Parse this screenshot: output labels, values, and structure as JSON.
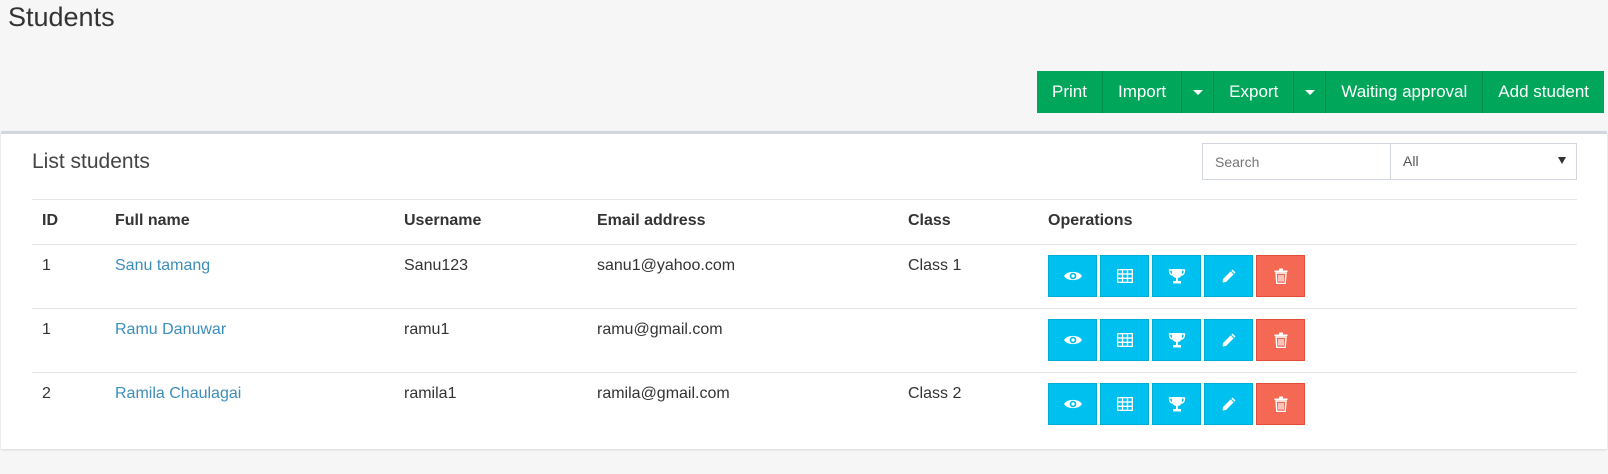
{
  "page": {
    "title": "Students"
  },
  "toolbar": {
    "print": "Print",
    "import": "Import",
    "export": "Export",
    "waiting_approval": "Waiting approval",
    "add_student": "Add student"
  },
  "panel": {
    "title": "List students",
    "search_placeholder": "Search",
    "filter_value": "All"
  },
  "table": {
    "columns": {
      "id": "ID",
      "full_name": "Full name",
      "username": "Username",
      "email": "Email address",
      "class": "Class",
      "operations": "Operations"
    },
    "rows": [
      {
        "id": "1",
        "full_name": "Sanu tamang",
        "username": "Sanu123",
        "email": "sanu1@yahoo.com",
        "class": "Class 1"
      },
      {
        "id": "1",
        "full_name": "Ramu Danuwar",
        "username": "ramu1",
        "email": "ramu@gmail.com",
        "class": ""
      },
      {
        "id": "2",
        "full_name": "Ramila Chaulagai",
        "username": "ramila1",
        "email": "ramila@gmail.com",
        "class": "Class 2"
      }
    ],
    "operation_icons": [
      "eye-icon",
      "table-icon",
      "trophy-icon",
      "pencil-icon",
      "trash-icon"
    ]
  },
  "colors": {
    "success": "#00a65a",
    "info": "#00c0ef",
    "danger": "#f56954",
    "link": "#3c8dbc"
  }
}
